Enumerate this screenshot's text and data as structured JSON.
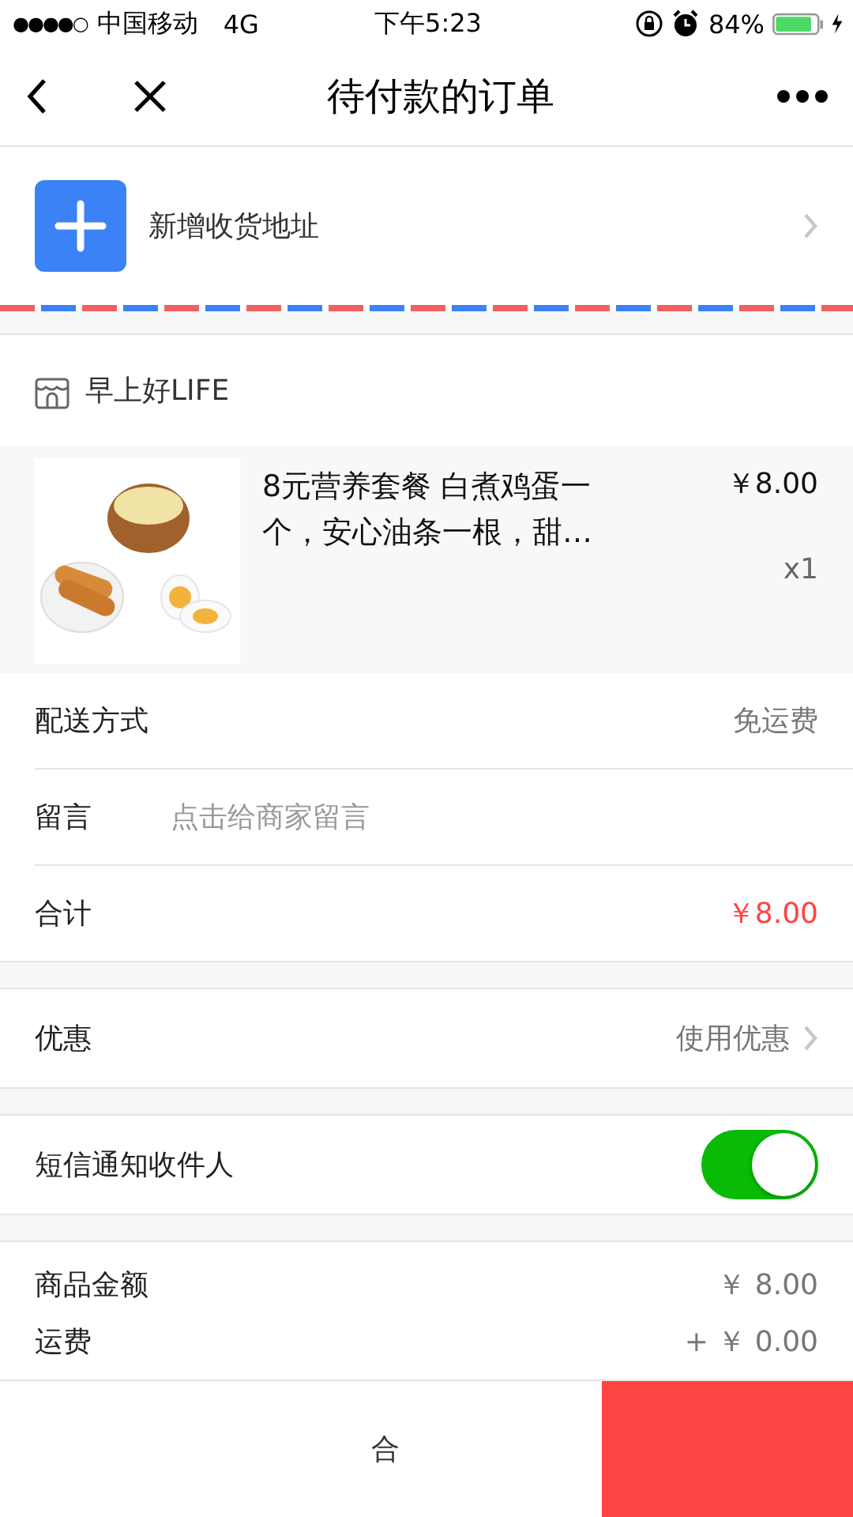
{
  "status_bar": {
    "signal_dots": "●●●●○",
    "carrier": "中国移动",
    "network": "4G",
    "time": "下午5:23",
    "battery": "84%"
  },
  "nav": {
    "title": "待付款的订单"
  },
  "address": {
    "label": "新增收货地址"
  },
  "shop": {
    "name": "早上好LIFE"
  },
  "product": {
    "title": "8元营养套餐 白煮鸡蛋一个，安心油条一根，甜…",
    "price": "￥8.00",
    "quantity": "x1"
  },
  "rows": [
    {
      "kind": "value",
      "label": "配送方式",
      "value": "免运费"
    },
    {
      "kind": "input",
      "label": "留言",
      "placeholder": "点击给商家留言"
    },
    {
      "kind": "total",
      "label": "合计",
      "value": "￥8.00"
    }
  ],
  "coupon": {
    "label": "优惠",
    "value": "使用优惠"
  },
  "sms": {
    "label": "短信通知收件人",
    "on": true
  },
  "summary": [
    {
      "label": "商品金额",
      "value": "￥ 8.00"
    },
    {
      "label": "运费",
      "value": "+ ￥ 0.00"
    }
  ],
  "bottom_bar": {
    "total_fragment": "合"
  }
}
